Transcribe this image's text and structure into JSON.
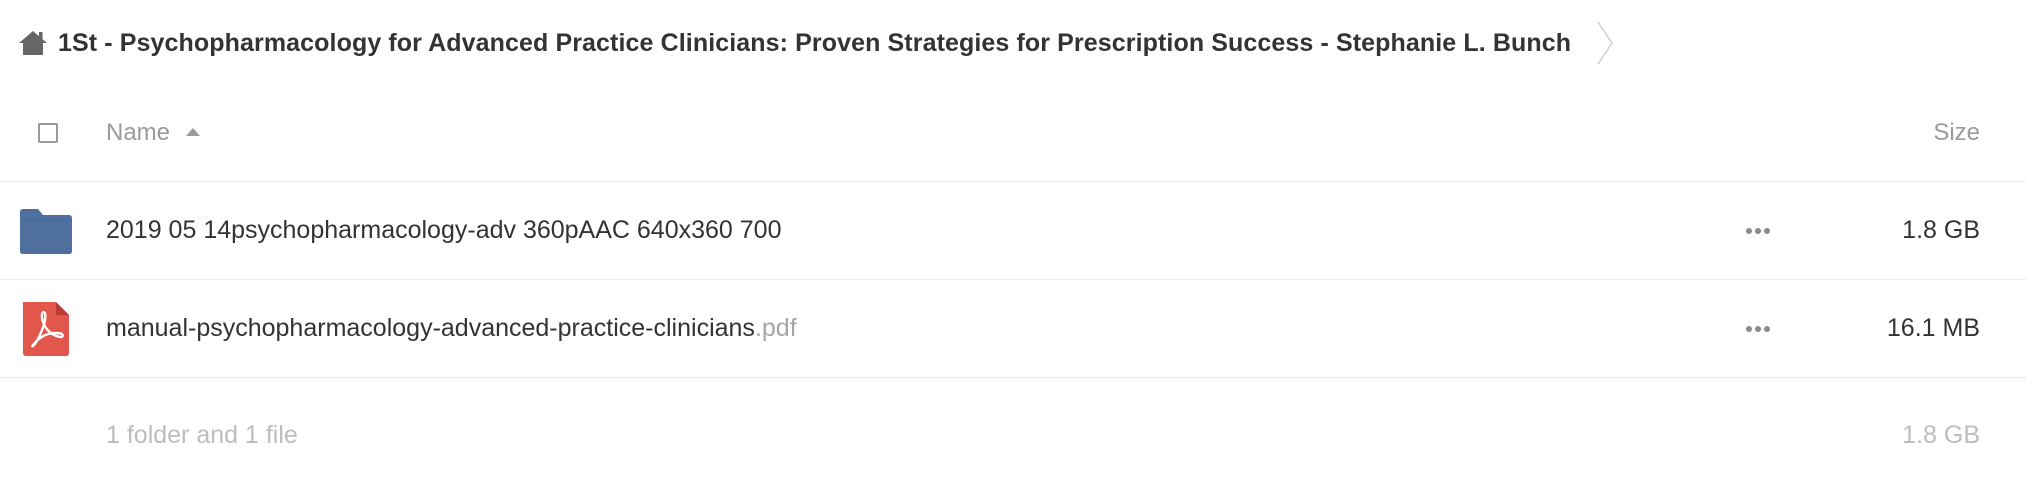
{
  "breadcrumb": {
    "home_icon": "home-icon",
    "current": "1St - Psychopharmacology for Advanced Practice Clinicians: Proven Strategies for Prescription Success - Stephanie L. Bunch",
    "separator_icon": "chevron-right-icon"
  },
  "table": {
    "columns": {
      "name": "Name",
      "size": "Size"
    },
    "sort": {
      "column": "name",
      "direction": "ascending"
    },
    "rows": [
      {
        "type": "folder",
        "icon": "folder-icon",
        "icon_color": "#4f6f9e",
        "name": "2019 05 14psychopharmacology-adv 360pAAC 640x360 700",
        "extension": "",
        "size": "1.8 GB"
      },
      {
        "type": "file",
        "icon": "pdf-icon",
        "icon_color": "#e2574c",
        "name": "manual-psychopharmacology-advanced-practice-clinicians",
        "extension": ".pdf",
        "size": "16.1 MB"
      }
    ],
    "summary": {
      "text": "1 folder and 1 file",
      "size": "1.8 GB"
    }
  },
  "colors": {
    "text": "#333333",
    "muted": "#9a9a9a",
    "faint": "#bdbdbd",
    "divider": "#ebebeb"
  }
}
